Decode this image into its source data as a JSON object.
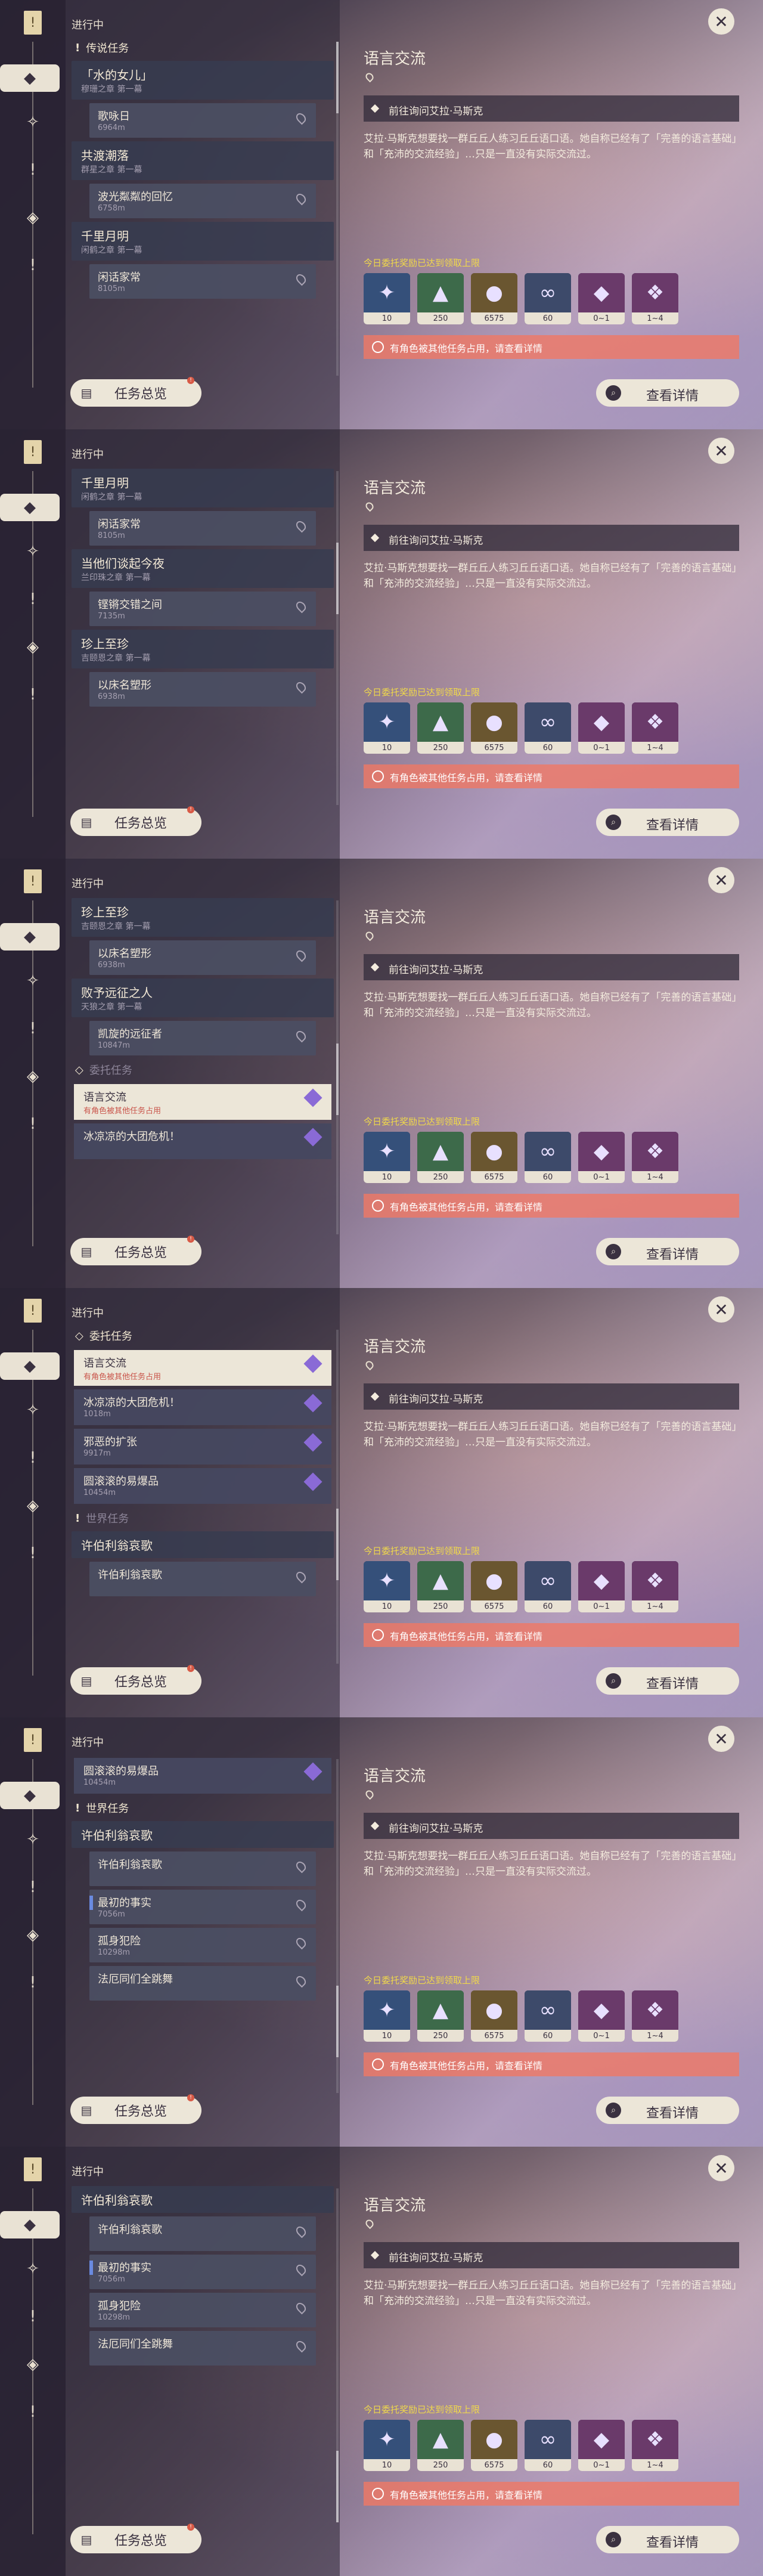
{
  "common": {
    "status": "进行中",
    "overview_label": "任务总览",
    "detail_button": "查看详情",
    "close_symbol": "✕",
    "detail": {
      "title": "语言交流",
      "objective": "前往询问艾拉·马斯克",
      "description": "艾拉·马斯克想要找一群丘丘人练习丘丘语口语。她自称已经有了「完善的语言基础」和「充沛的交流经验」…只是一直没有实际交流过。",
      "reward_note": "今日委托奖励已达到领取上限",
      "warning": "有角色被其他任务占用，请查看详情"
    },
    "rewards": [
      {
        "name": "starglitter-icon",
        "count": "10"
      },
      {
        "name": "hero-wit-icon",
        "count": "250"
      },
      {
        "name": "mora-icon",
        "count": "6575"
      },
      {
        "name": "companionship-icon",
        "count": "60"
      },
      {
        "name": "crystal-chunk-icon",
        "count": "0~1"
      },
      {
        "name": "crystal-gem-icon",
        "count": "1~4"
      }
    ]
  },
  "screens": [
    {
      "items": [
        {
          "kind": "cat",
          "mark": "!",
          "label": "传说任务"
        },
        {
          "kind": "quest",
          "title": "「水的女儿」",
          "sub": "穆珊之章 第一幕"
        },
        {
          "kind": "step",
          "title": "歌咏日",
          "dist": "6964m"
        },
        {
          "kind": "quest",
          "title": "共渡潮落",
          "sub": "群星之章 第一幕"
        },
        {
          "kind": "step",
          "title": "波光粼粼的回忆",
          "dist": "6758m"
        },
        {
          "kind": "quest",
          "title": "千里月明",
          "sub": "闲鹤之章 第一幕"
        },
        {
          "kind": "step",
          "title": "闲话家常",
          "dist": "8105m"
        }
      ]
    },
    {
      "items": [
        {
          "kind": "quest",
          "title": "千里月明",
          "sub": "闲鹤之章 第一幕"
        },
        {
          "kind": "step",
          "title": "闲话家常",
          "dist": "8105m"
        },
        {
          "kind": "quest",
          "title": "当他们谈起今夜",
          "sub": "兰印珠之章 第一幕"
        },
        {
          "kind": "step",
          "title": "铿锵交错之间",
          "dist": "7135m"
        },
        {
          "kind": "quest",
          "title": "珍上至珍",
          "sub": "吉颐恩之章 第一幕"
        },
        {
          "kind": "step",
          "title": "以床名塑形",
          "dist": "6938m"
        }
      ]
    },
    {
      "items": [
        {
          "kind": "quest",
          "title": "珍上至珍",
          "sub": "吉颐恩之章 第一幕"
        },
        {
          "kind": "step",
          "title": "以床名塑形",
          "dist": "6938m"
        },
        {
          "kind": "quest",
          "title": "败予远征之人",
          "sub": "天狼之章 第一幕"
        },
        {
          "kind": "step",
          "title": "凯旋的远征者",
          "dist": "10847m"
        },
        {
          "kind": "cat",
          "mark": "◇",
          "label": "委托任务",
          "dim": true
        },
        {
          "kind": "commission",
          "title": "语言交流",
          "dist": "有角色被其他任务占用",
          "selected": true
        },
        {
          "kind": "commission",
          "title": "冰凉凉的大团危机！",
          "dist": ""
        }
      ]
    },
    {
      "items": [
        {
          "kind": "cat",
          "mark": "◇",
          "label": "委托任务"
        },
        {
          "kind": "commission",
          "title": "语言交流",
          "dist": "有角色被其他任务占用",
          "selected": true
        },
        {
          "kind": "commission",
          "title": "冰凉凉的大团危机！",
          "dist": "1018m"
        },
        {
          "kind": "commission",
          "title": "邪恶的扩张",
          "dist": "9917m"
        },
        {
          "kind": "commission",
          "title": "圆滚滚的易爆品",
          "dist": "10454m"
        },
        {
          "kind": "cat",
          "mark": "!",
          "label": "世界任务",
          "dim": true
        },
        {
          "kind": "quest",
          "title": "许伯利翁哀歌",
          "sub": ""
        },
        {
          "kind": "step",
          "title": "许伯利翁哀歌",
          "dist": ""
        }
      ]
    },
    {
      "items": [
        {
          "kind": "commission",
          "title": "圆滚滚的易爆品",
          "dist": "10454m"
        },
        {
          "kind": "cat",
          "mark": "!",
          "label": "世界任务"
        },
        {
          "kind": "quest",
          "title": "许伯利翁哀歌",
          "sub": ""
        },
        {
          "kind": "step",
          "title": "许伯利翁哀歌",
          "dist": ""
        },
        {
          "kind": "step",
          "title": "最初的事实",
          "dist": "7056m",
          "tab": true
        },
        {
          "kind": "step",
          "title": "孤身犯险",
          "dist": "10298m"
        },
        {
          "kind": "step",
          "title": "法厄同们全跳舞",
          "dist": ""
        }
      ]
    },
    {
      "items": [
        {
          "kind": "quest",
          "title": "许伯利翁哀歌",
          "sub": ""
        },
        {
          "kind": "step",
          "title": "许伯利翁哀歌",
          "dist": ""
        },
        {
          "kind": "step",
          "title": "最初的事实",
          "dist": "7056m",
          "tab": true
        },
        {
          "kind": "step",
          "title": "孤身犯险",
          "dist": "10298m"
        },
        {
          "kind": "step",
          "title": "法厄同们全跳舞",
          "dist": ""
        }
      ]
    }
  ]
}
